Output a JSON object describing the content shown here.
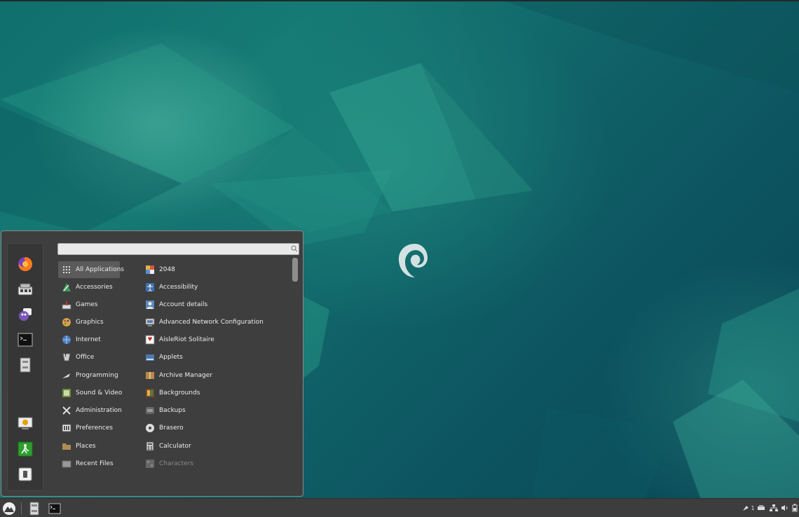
{
  "desktop": {
    "wallpaper": "debian-emerald-facets",
    "accent": "#0f6f6d"
  },
  "menu": {
    "search": {
      "value": "",
      "placeholder": ""
    },
    "favorites": [
      {
        "name": "firefox",
        "icon": "firefox-icon"
      },
      {
        "name": "software-manager",
        "icon": "software-icon"
      },
      {
        "name": "pidgin",
        "icon": "chat-icon"
      },
      {
        "name": "terminal",
        "icon": "terminal-icon"
      },
      {
        "name": "files",
        "icon": "file-cabinet-icon"
      }
    ],
    "session": [
      {
        "name": "lock-screen",
        "icon": "lock-screen-icon"
      },
      {
        "name": "logout",
        "icon": "logout-icon"
      },
      {
        "name": "shutdown",
        "icon": "power-icon"
      }
    ],
    "categories": [
      {
        "label": "All Applications",
        "icon": "grid-icon",
        "selected": true
      },
      {
        "label": "Accessories",
        "icon": "accessories-icon"
      },
      {
        "label": "Games",
        "icon": "games-icon"
      },
      {
        "label": "Graphics",
        "icon": "graphics-icon"
      },
      {
        "label": "Internet",
        "icon": "internet-icon"
      },
      {
        "label": "Office",
        "icon": "office-icon"
      },
      {
        "label": "Programming",
        "icon": "programming-icon"
      },
      {
        "label": "Sound & Video",
        "icon": "sound-video-icon"
      },
      {
        "label": "Administration",
        "icon": "administration-icon"
      },
      {
        "label": "Preferences",
        "icon": "preferences-icon"
      },
      {
        "label": "Places",
        "icon": "folder-icon"
      },
      {
        "label": "Recent Files",
        "icon": "recent-files-icon"
      }
    ],
    "apps": [
      {
        "label": "2048",
        "icon": "2048-icon"
      },
      {
        "label": "Accessibility",
        "icon": "accessibility-icon"
      },
      {
        "label": "Account details",
        "icon": "account-icon"
      },
      {
        "label": "Advanced Network Configuration",
        "icon": "network-config-icon"
      },
      {
        "label": "AisleRiot Solitaire",
        "icon": "cards-icon"
      },
      {
        "label": "Applets",
        "icon": "applets-icon"
      },
      {
        "label": "Archive Manager",
        "icon": "archive-icon"
      },
      {
        "label": "Backgrounds",
        "icon": "backgrounds-icon"
      },
      {
        "label": "Backups",
        "icon": "backups-icon"
      },
      {
        "label": "Brasero",
        "icon": "disc-icon"
      },
      {
        "label": "Calculator",
        "icon": "calculator-icon"
      },
      {
        "label": "Characters",
        "icon": "characters-icon",
        "dim": true
      }
    ]
  },
  "panel": {
    "launchers": [
      {
        "name": "menu-button",
        "icon": "cinnamon-menu-icon"
      },
      {
        "name": "files",
        "icon": "file-cabinet-icon"
      },
      {
        "name": "terminal",
        "icon": "terminal-icon"
      }
    ],
    "tray": {
      "notifications_count": "1",
      "icons": [
        "notifications-icon",
        "printer-icon",
        "network-icon",
        "volume-icon",
        "battery-icon"
      ]
    }
  }
}
